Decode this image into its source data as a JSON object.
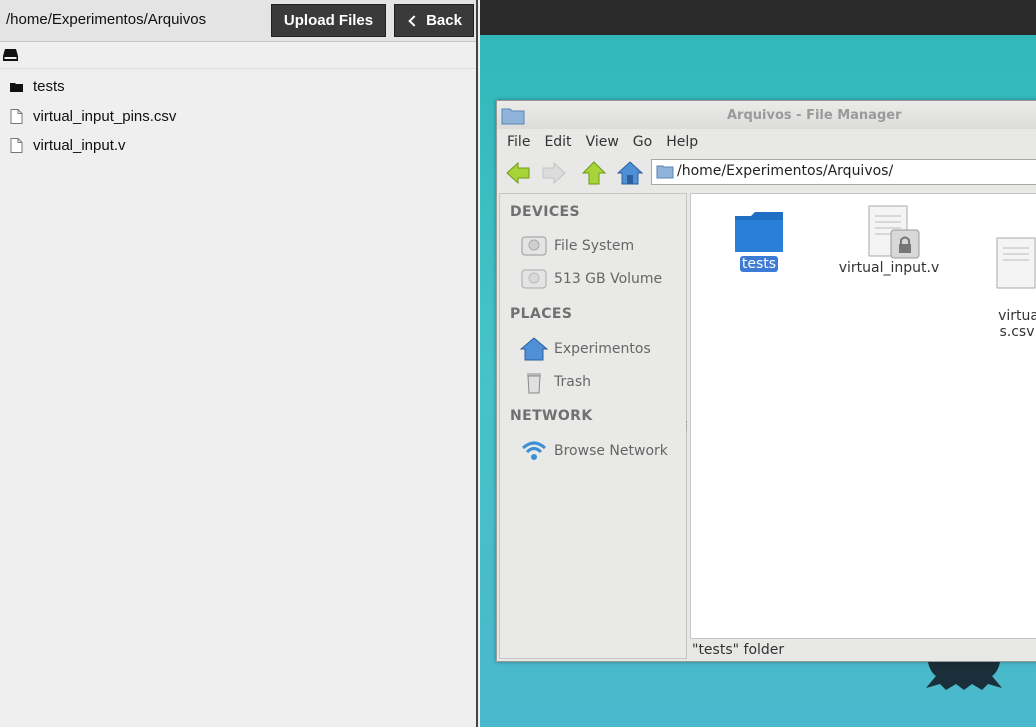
{
  "left_panel": {
    "path": "/home/Experimentos/Arquivos",
    "upload_label": "Upload Files",
    "back_label": "Back",
    "drive_icon": "drive-icon",
    "files": [
      {
        "name": "tests",
        "icon": "folder-icon"
      },
      {
        "name": "virtual_input_pins.csv",
        "icon": "file-icon"
      },
      {
        "name": "virtual_input.v",
        "icon": "file-icon"
      }
    ]
  },
  "file_manager": {
    "title": "Arquivos - File Manager",
    "menu": [
      "File",
      "Edit",
      "View",
      "Go",
      "Help"
    ],
    "address": "/home/Experimentos/Arquivos/",
    "sidebar": {
      "devices_header": "DEVICES",
      "devices": [
        "File System",
        "513 GB Volume"
      ],
      "places_header": "PLACES",
      "places": [
        "Experimentos",
        "Trash"
      ],
      "network_header": "NETWORK",
      "network": [
        "Browse Network"
      ]
    },
    "items": [
      {
        "name": "tests",
        "icon": "folder-icon",
        "selected": true
      },
      {
        "name": "virtual_input.v",
        "icon": "text-file-locked-icon"
      },
      {
        "name": "virtual_inp\ns.csv",
        "icon": "text-file-icon"
      }
    ],
    "status": "\"tests\" folder"
  },
  "colors": {
    "desktop": "#3ebfc4",
    "selection": "#3b7bd6",
    "button_dark": "#3a3a3a"
  }
}
